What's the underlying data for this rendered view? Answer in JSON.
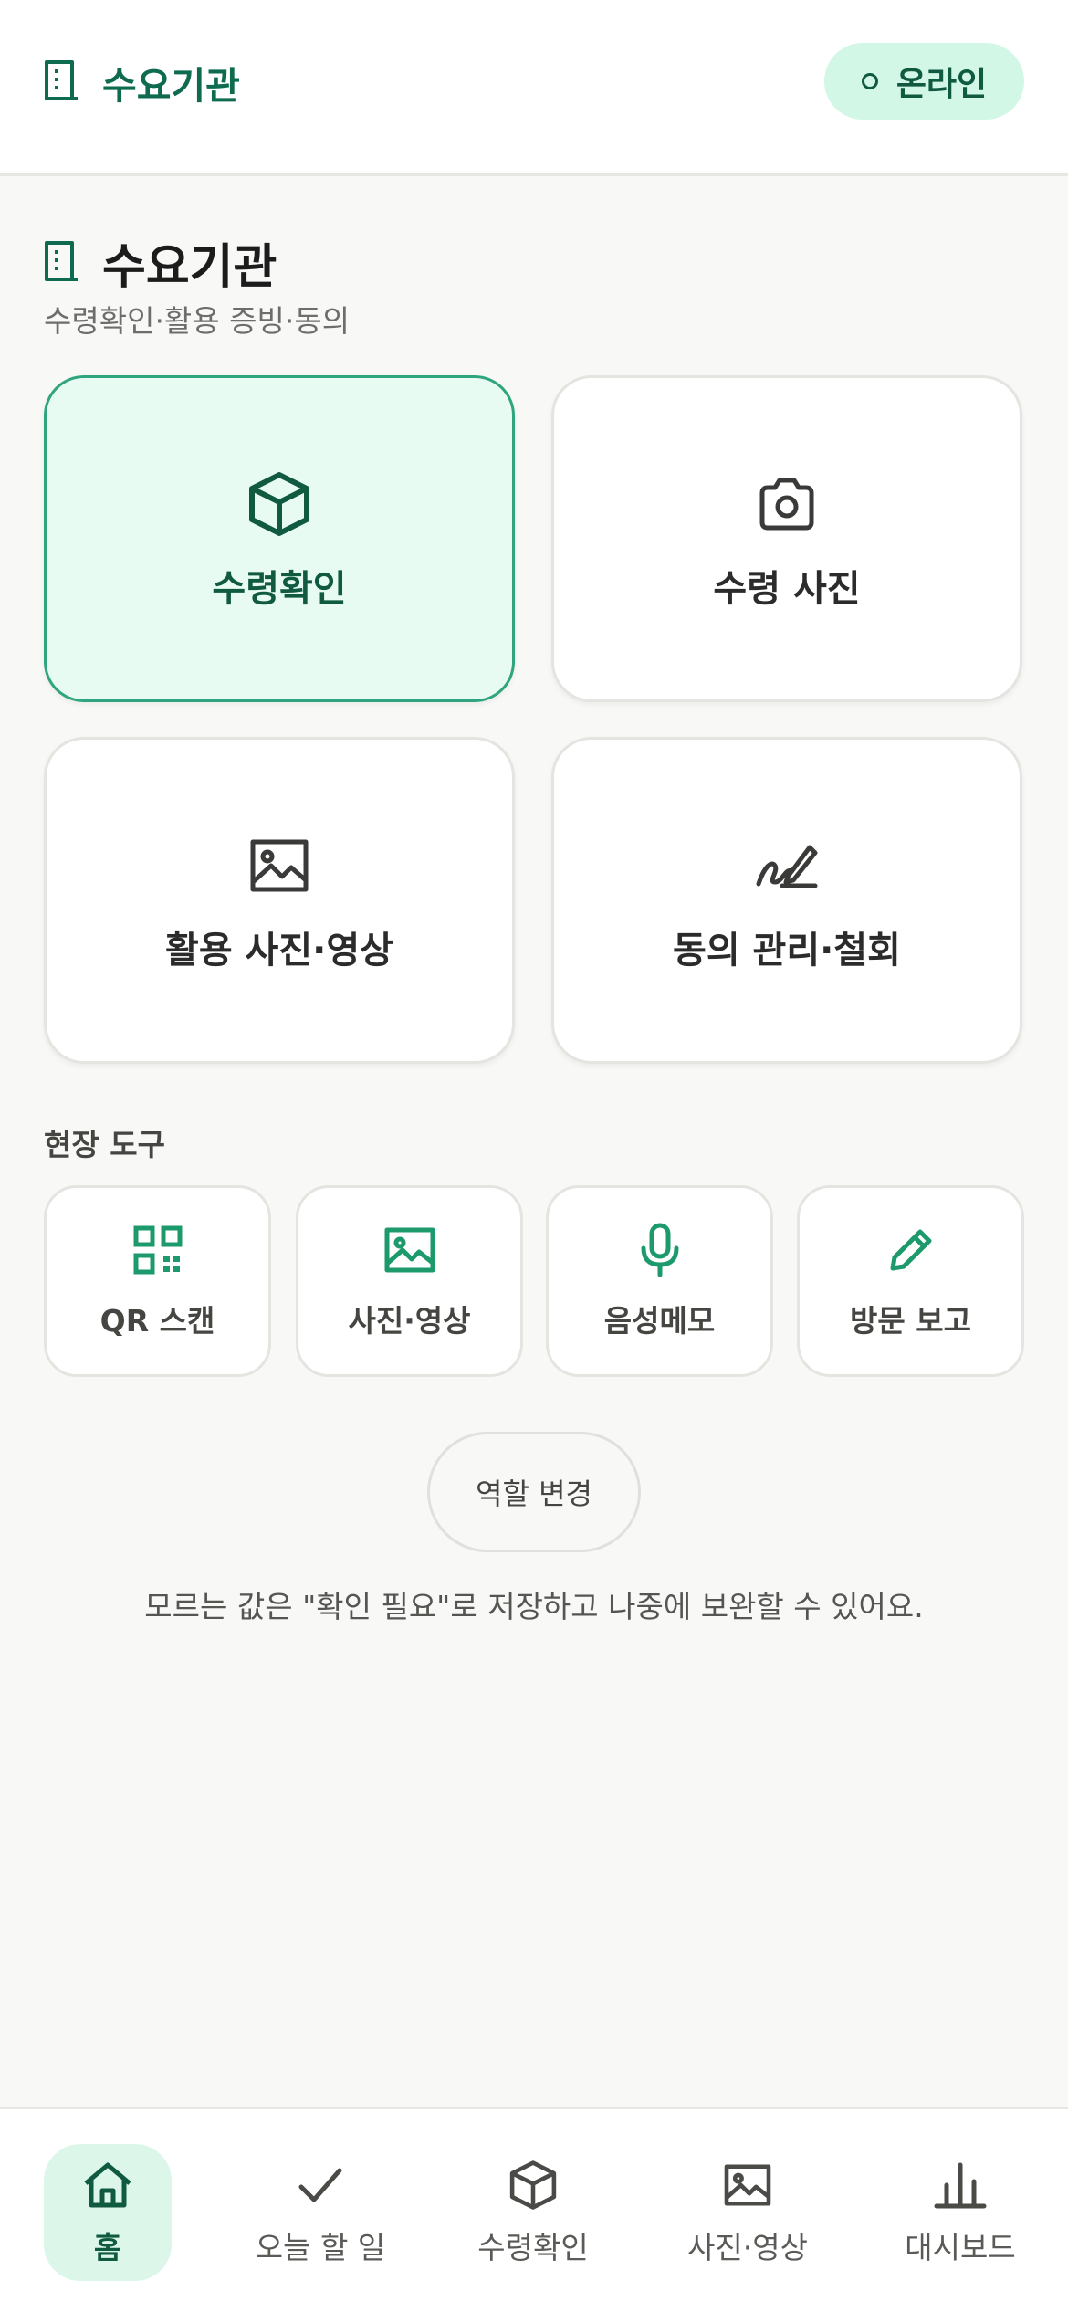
{
  "app_bar": {
    "title": "수요기관",
    "title_icon": "building-icon",
    "status_label": "온라인"
  },
  "section": {
    "title": "수요기관",
    "subtitle": "수령확인·활용 증빙·동의",
    "icon": "building-icon"
  },
  "main_actions": [
    {
      "label": "수령확인",
      "icon": "box-icon",
      "selected": true
    },
    {
      "label": "수령 사진",
      "icon": "camera-icon",
      "selected": false
    },
    {
      "label": "활용 사진·영상",
      "icon": "image-icon",
      "selected": false
    },
    {
      "label": "동의 관리·철회",
      "icon": "signature-icon",
      "selected": false
    }
  ],
  "tools": {
    "title": "현장 도구",
    "items": [
      {
        "label": "QR 스캔",
        "icon": "qr-icon"
      },
      {
        "label": "사진·영상",
        "icon": "image-icon"
      },
      {
        "label": "음성메모",
        "icon": "microphone-icon"
      },
      {
        "label": "방문 보고",
        "icon": "pencil-icon"
      }
    ]
  },
  "role_button_label": "역할 변경",
  "hint_text": "모르는 값은 \"확인 필요\"로 저장하고 나중에 보완할 수 있어요.",
  "bottom_nav": [
    {
      "label": "홈",
      "icon": "home-icon",
      "active": true
    },
    {
      "label": "오늘 할 일",
      "icon": "check-icon",
      "active": false
    },
    {
      "label": "수령확인",
      "icon": "box-icon",
      "active": false
    },
    {
      "label": "사진·영상",
      "icon": "image-icon",
      "active": false
    },
    {
      "label": "대시보드",
      "icon": "bar-chart-icon",
      "active": false
    }
  ],
  "colors": {
    "accent": "#0f6b4f",
    "accent_light": "#d3f7e6",
    "active_card_bg": "#e8fbf2",
    "active_card_border": "#2fa57f",
    "background": "#f8f8f6"
  }
}
